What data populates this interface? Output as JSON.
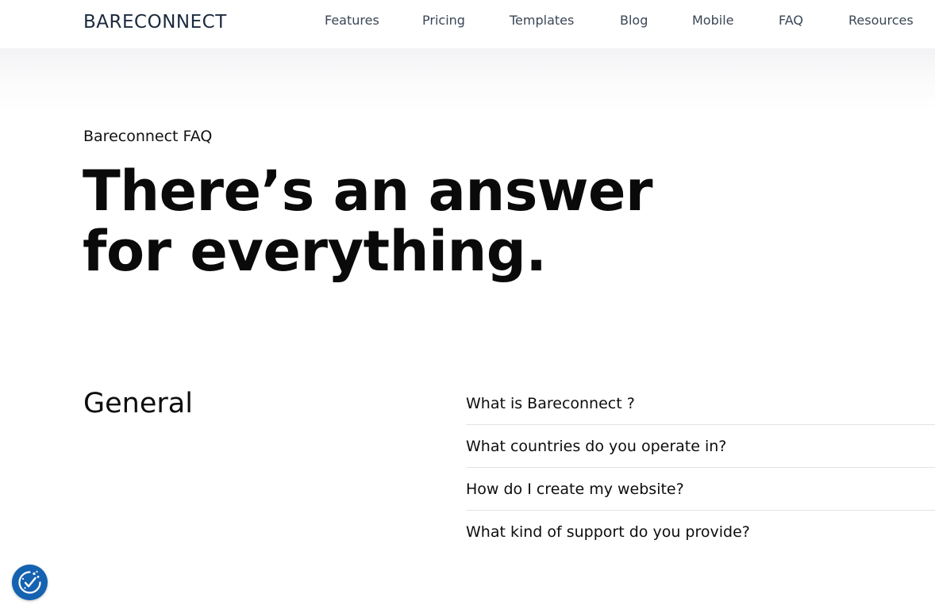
{
  "header": {
    "logo_text": "BARECONNECT",
    "nav_items": [
      {
        "label": "Features"
      },
      {
        "label": "Pricing"
      },
      {
        "label": "Templates"
      },
      {
        "label": "Blog"
      },
      {
        "label": "Mobile"
      },
      {
        "label": "FAQ"
      },
      {
        "label": "Resources"
      }
    ]
  },
  "hero": {
    "eyebrow": "Bareconnect FAQ",
    "title_line1": "There’s an answer",
    "title_line2": "for everything."
  },
  "faq": {
    "section_title": "General",
    "questions": [
      {
        "q": "What is Bareconnect ?"
      },
      {
        "q": "What countries do you operate in?"
      },
      {
        "q": "How do I create my website?"
      },
      {
        "q": "What kind of support do you provide?"
      }
    ]
  },
  "privacy_button": {
    "icon": "cookie-consent-icon",
    "color": "#1562b0"
  },
  "colors": {
    "logo": "#1c2a3e",
    "nav_text": "#3a4656",
    "text": "#0b0b0b",
    "divider": "#e3e3e3"
  }
}
